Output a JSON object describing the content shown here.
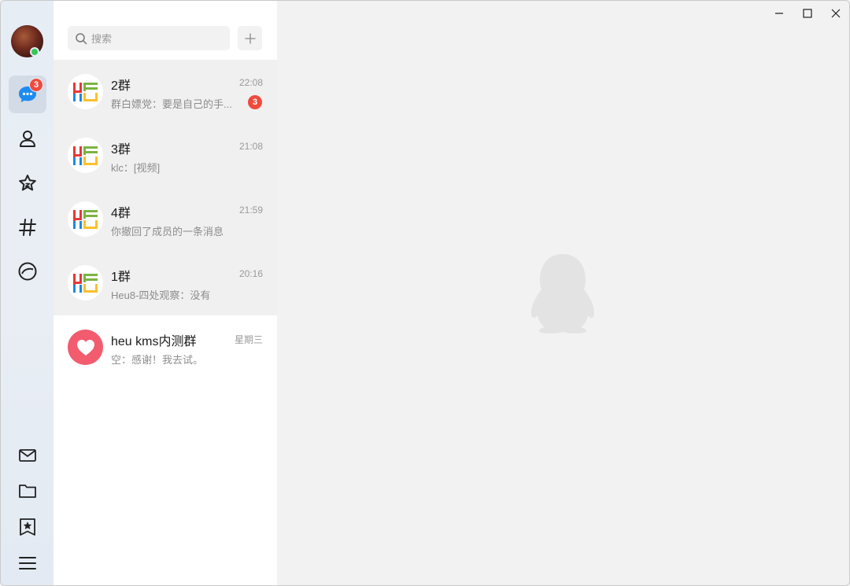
{
  "app": {
    "title": "QQ"
  },
  "rail": {
    "messages_badge": "3",
    "items": [
      {
        "name": "messages",
        "icon": "chat-bubble-icon"
      },
      {
        "name": "contacts",
        "icon": "person-icon"
      },
      {
        "name": "favorites",
        "icon": "star-icon"
      },
      {
        "name": "channels",
        "icon": "hashtag-icon"
      },
      {
        "name": "discover",
        "icon": "circle-swirl-icon"
      }
    ],
    "bottom_items": [
      {
        "name": "mail",
        "icon": "mail-icon"
      },
      {
        "name": "files",
        "icon": "folder-icon"
      },
      {
        "name": "bookmarks",
        "icon": "bookmark-star-icon"
      },
      {
        "name": "menu",
        "icon": "menu-icon"
      }
    ]
  },
  "search": {
    "placeholder": "搜索",
    "add_label": "+"
  },
  "conversations": [
    {
      "name": "2群",
      "preview": "群白嫖党：要是自己的手...",
      "time": "22:08",
      "unread": "3"
    },
    {
      "name": "3群",
      "preview": "klc：[视频]",
      "time": "21:08",
      "unread": ""
    },
    {
      "name": "4群",
      "preview": "你撤回了成员的一条消息",
      "time": "21:59",
      "unread": ""
    },
    {
      "name": "1群",
      "preview": "Heu8-四处观察：没有",
      "time": "20:16",
      "unread": ""
    },
    {
      "name": "heu kms内测群",
      "preview": "空：感谢！我去试。",
      "time": "星期三",
      "unread": ""
    }
  ],
  "colors": {
    "accent": "#1d8bf1",
    "badge": "#f04a3c",
    "online": "#34c759",
    "heart": "#f25c6e"
  }
}
